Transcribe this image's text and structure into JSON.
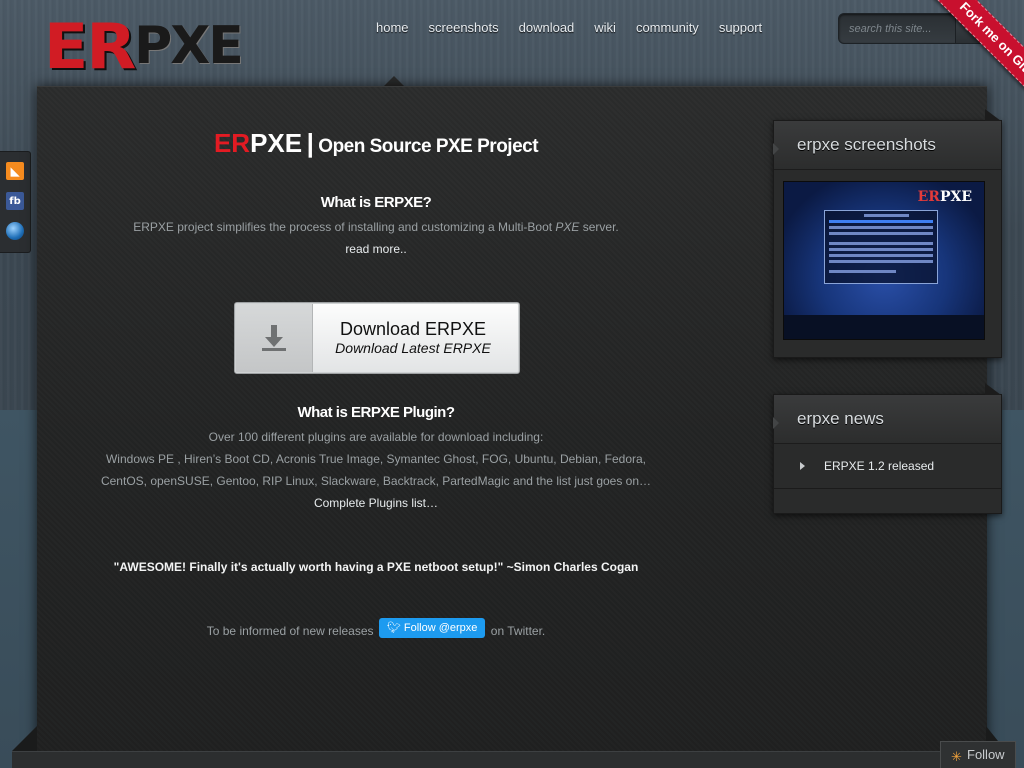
{
  "logo": {
    "er": "ER",
    "pxe": "PXE"
  },
  "nav": {
    "items": [
      {
        "label": "home"
      },
      {
        "label": "screenshots"
      },
      {
        "label": "download"
      },
      {
        "label": "wiki"
      },
      {
        "label": "community"
      },
      {
        "label": "support"
      }
    ]
  },
  "search": {
    "placeholder": "search this site...",
    "button_icon": "search-icon"
  },
  "ribbon": {
    "label": "Fork me on GitHub"
  },
  "social": {
    "items": [
      "rss-icon",
      "facebook-icon",
      "web-icon"
    ],
    "fb_text": "fb"
  },
  "main": {
    "title_er": "ER",
    "title_pxe": "PXE",
    "title_sep": "|",
    "title_sub": "Open Source PXE Project",
    "about_heading": "What is ERPXE?",
    "about_text_1": "ERPXE project simplifies the process of installing and customizing a Multi-Boot ",
    "about_text_em": "PXE",
    "about_text_2": " server.",
    "read_more": "read more..",
    "download_title": "Download ERPXE",
    "download_subtitle": "Download Latest ERPXE",
    "plugin_heading": "What is ERPXE Plugin?",
    "plugin_line_1": "Over 100 different plugins are available for download including:",
    "plugin_line_2": "Windows PE , Hiren’s Boot CD, Acronis True Image, Symantec Ghost, FOG, Ubuntu, Debian, Fedora,",
    "plugin_line_3": "CentOS, openSUSE, Gentoo, RIP Linux, Slackware, Backtrack, PartedMagic and the list just goes on…",
    "plugin_link": "Complete Plugins list…",
    "quote": "\"AWESOME! Finally it's actually worth having a PXE netboot setup!\" ~Simon Charles Cogan",
    "twitter_prefix": "To be informed of new releases",
    "twitter_button": "Follow @erpxe",
    "twitter_suffix": "on Twitter."
  },
  "sidebar": {
    "screenshots_title": "erpxe screenshots",
    "news_title": "erpxe news",
    "news_items": [
      {
        "label": "ERPXE 1.2 released"
      }
    ]
  },
  "follow": {
    "label": "Follow"
  },
  "colors": {
    "accent_red": "#e31b23",
    "twitter_blue": "#1d9bf0",
    "panel_bg": "#262727"
  }
}
